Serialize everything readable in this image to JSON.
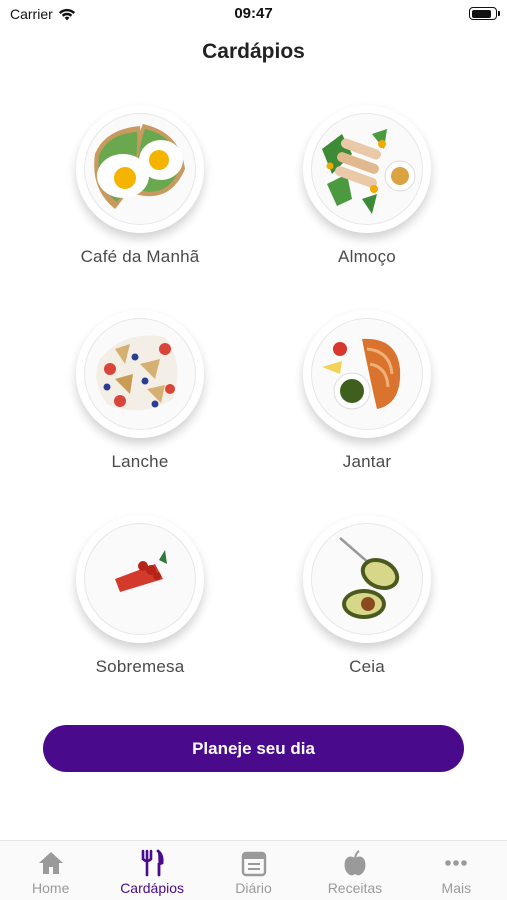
{
  "status": {
    "carrier": "Carrier",
    "time": "09:47",
    "battery_level": 0.9
  },
  "page": {
    "title": "Cardápios"
  },
  "menus": [
    {
      "label": "Café da Manhã",
      "icon": "fried-eggs-toast-icon"
    },
    {
      "label": "Almoço",
      "icon": "chicken-salad-icon"
    },
    {
      "label": "Lanche",
      "icon": "granola-fruit-icon"
    },
    {
      "label": "Jantar",
      "icon": "salmon-steak-icon"
    },
    {
      "label": "Sobremesa",
      "icon": "berry-dessert-icon"
    },
    {
      "label": "Ceia",
      "icon": "avocado-icon"
    }
  ],
  "actions": {
    "plan_day": "Planeje seu dia"
  },
  "tabbar": {
    "active": "Cardápios",
    "active_color": "#4a0a8c",
    "inactive_color": "#9a9a9a",
    "items": [
      {
        "label": "Home",
        "icon": "home-icon"
      },
      {
        "label": "Cardápios",
        "icon": "fork-knife-icon"
      },
      {
        "label": "Diário",
        "icon": "calendar-icon"
      },
      {
        "label": "Receitas",
        "icon": "apple-icon"
      },
      {
        "label": "Mais",
        "icon": "more-dots-icon"
      }
    ]
  }
}
